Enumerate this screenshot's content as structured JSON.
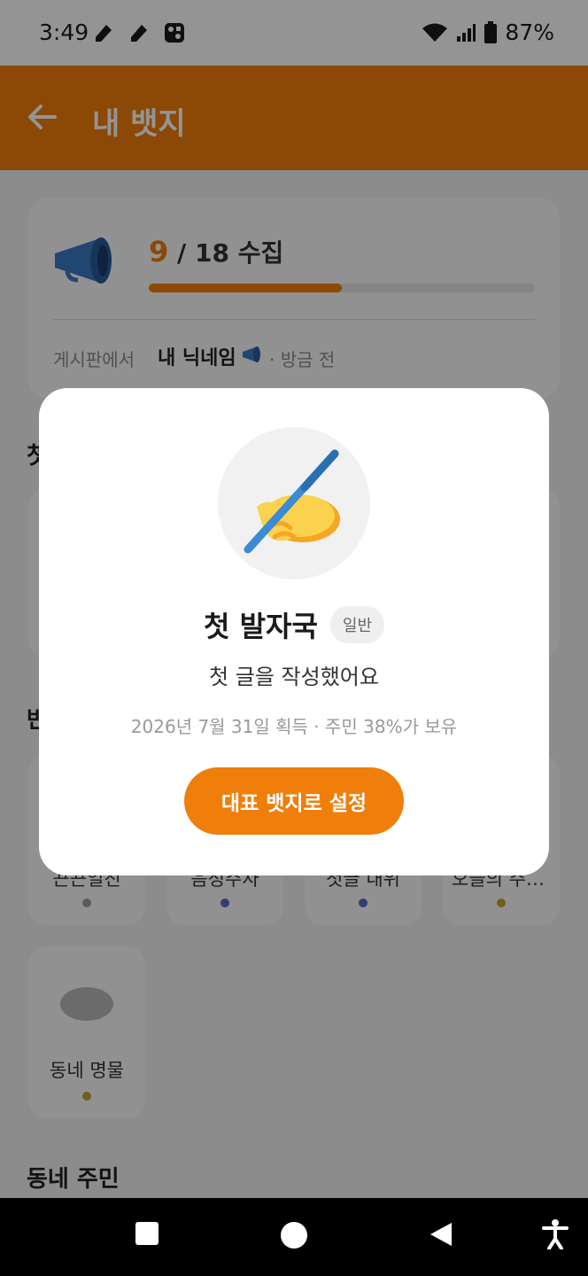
{
  "status_bar": {
    "time": "3:49",
    "battery": "87%",
    "icons": [
      "pencil-notification-icon",
      "pencil-notification-icon",
      "puzzle-app-icon",
      "wifi-icon",
      "cellular-signal-icon",
      "battery-icon"
    ]
  },
  "app_bar": {
    "title": "내 뱃지",
    "back_icon": "arrow-left-icon",
    "color": "#f07e0a"
  },
  "summary": {
    "collected": "9",
    "total_label": " / 18 수집",
    "progress": 0.5,
    "location_label": "게시판에서",
    "nickname": "내 닉네임",
    "time_label": "· 방금 전"
  },
  "sections": {
    "first_partial": "첫",
    "second_partial": "반",
    "neighborhood": "동네 주민"
  },
  "badges": [
    {
      "name": "끈끈일진",
      "dot_color": "#9e9e9e"
    },
    {
      "name": "음정주자",
      "dot_color": "#5c6bc0"
    },
    {
      "name": "첫글 내위",
      "dot_color": "#5c6bc0"
    },
    {
      "name": "오늘의 주인...",
      "dot_color": "#c9a227"
    },
    {
      "name": "동네 명물",
      "dot_color": "#c9a227"
    }
  ],
  "dialog": {
    "badge_icon": "writing-hand-icon",
    "badge_name": "첫 발자국",
    "rarity_tag": "일반",
    "description": "첫 글을 작성했어요",
    "meta": "2026년 7월 31일 획득 · 주민 38%가 보유",
    "cta_label": "대표 뱃지로 설정"
  },
  "nav_bar": {
    "icons": [
      "recent-apps-icon",
      "home-icon",
      "back-icon",
      "accessibility-icon"
    ]
  }
}
